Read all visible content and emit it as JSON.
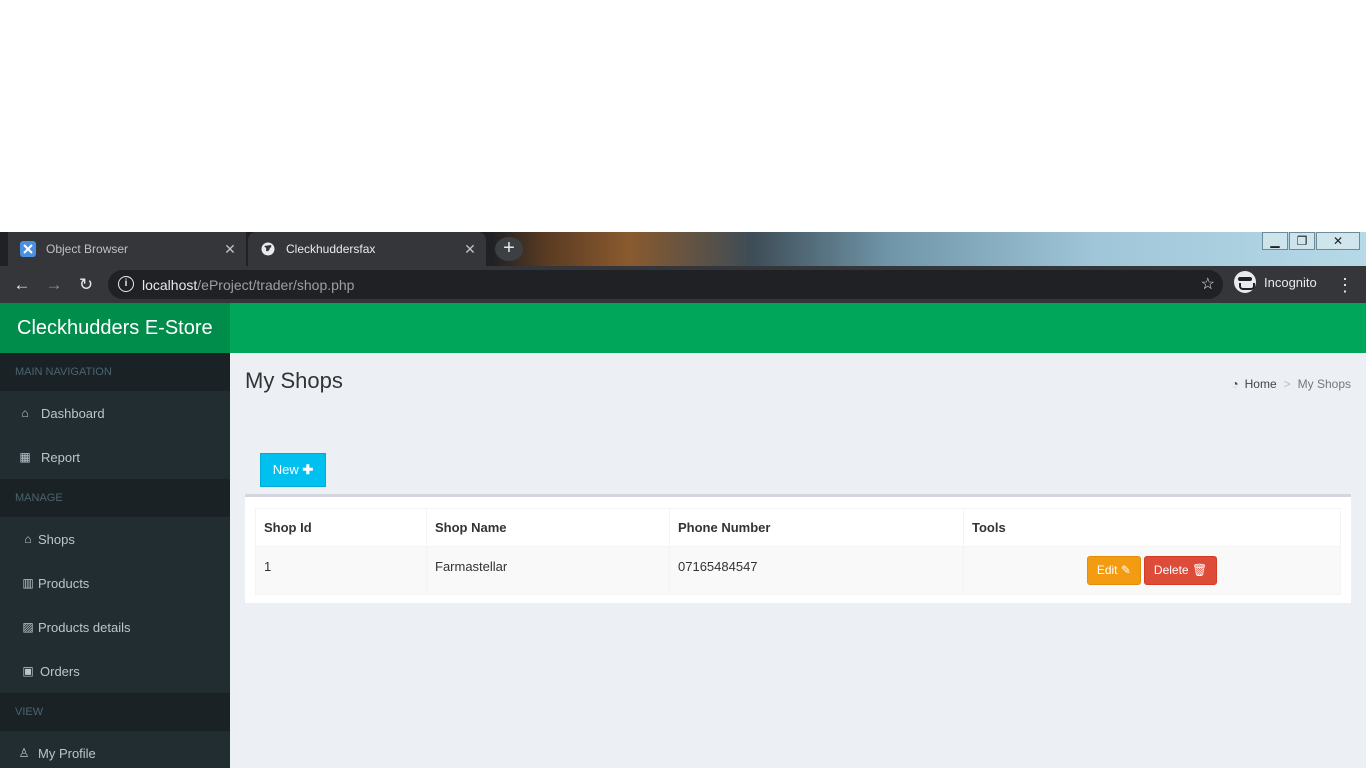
{
  "browser": {
    "tabs": [
      {
        "title": "Object Browser",
        "active": false
      },
      {
        "title": "Cleckhuddersfax",
        "active": true
      }
    ],
    "url_host": "localhost",
    "url_path": "/eProject/trader/shop.php",
    "profile_label": "Incognito"
  },
  "app": {
    "brand": "Cleckhudders E-Store",
    "theme_color": "#00a65a"
  },
  "sidebar": {
    "sections": [
      {
        "header": "MAIN NAVIGATION",
        "items": [
          {
            "label": "Dashboard",
            "icon": "home-icon"
          },
          {
            "label": "Report",
            "icon": "table-icon"
          }
        ]
      },
      {
        "header": "MANAGE",
        "items": [
          {
            "label": "Shops",
            "icon": "home-icon"
          },
          {
            "label": "Products",
            "icon": "barcode-icon"
          },
          {
            "label": "Products details",
            "icon": "image-icon"
          },
          {
            "label": "Orders",
            "icon": "money-icon"
          }
        ]
      },
      {
        "header": "VIEW",
        "items": [
          {
            "label": "My Profile",
            "icon": "user-icon"
          }
        ]
      }
    ]
  },
  "page": {
    "title": "My Shops",
    "breadcrumb": {
      "home": "Home",
      "current": "My Shops"
    },
    "new_button": "New",
    "table": {
      "headers": [
        "Shop Id",
        "Shop Name",
        "Phone Number",
        "Tools"
      ],
      "rows": [
        {
          "id": "1",
          "name": "Farmastellar",
          "phone": "07165484547"
        }
      ],
      "edit_label": "Edit",
      "delete_label": "Delete"
    }
  }
}
